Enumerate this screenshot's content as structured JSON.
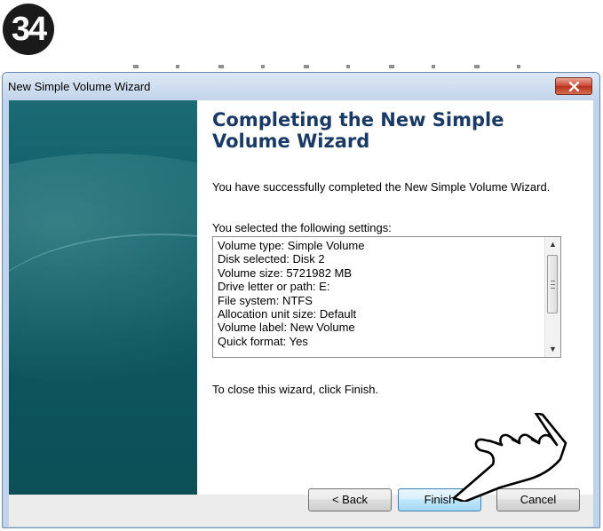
{
  "step_badge": "34",
  "window": {
    "title": "New Simple Volume Wizard",
    "close_icon": "close-icon"
  },
  "content": {
    "heading": "Completing the New Simple Volume Wizard",
    "description": "You have successfully completed the New Simple Volume Wizard.",
    "settings_label": "You selected the following settings:",
    "settings": [
      "Volume type: Simple Volume",
      "Disk selected: Disk 2",
      "Volume size: 5721982 MB",
      "Drive letter or path: E:",
      "File system: NTFS",
      "Allocation unit size: Default",
      "Volume label: New Volume",
      "Quick format: Yes"
    ],
    "close_hint": "To close this wizard, click Finish."
  },
  "buttons": {
    "back": "< Back",
    "finish": "Finish",
    "cancel": "Cancel"
  },
  "colors": {
    "heading": "#1a3a66",
    "side_panel": "#0f5a63",
    "close_button": "#c7432e"
  }
}
